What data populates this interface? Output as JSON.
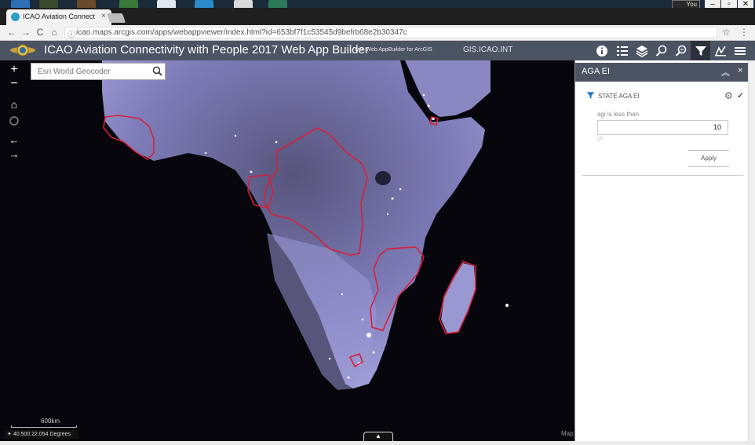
{
  "os": {
    "user_label": "You"
  },
  "browser": {
    "tab_title": "ICAO Aviation Connecti",
    "tab_close": "×",
    "url": "icao.maps.arcgis.com/apps/webappviewer/index.html?id=653bf7f1c53545d9befrb68e2b30347c",
    "back": "←",
    "forward": "→",
    "reload": "C",
    "home": "⌂",
    "info": "ⓘ",
    "star": "☆",
    "menu": "⋮"
  },
  "app": {
    "title": "ICAO Aviation Connectivity with People 2017 Web App Builder",
    "subtitle": "with Web AppBuilder for ArcGIS",
    "link": "GIS.ICAO.INT",
    "header_icons": [
      "info-icon",
      "legend-icon",
      "layers-icon",
      "query-icon",
      "query-alt-icon",
      "filter-icon",
      "analysis-icon",
      "menu-icon"
    ]
  },
  "map": {
    "zoom_in": "+",
    "zoom_out": "−",
    "home": "⌂",
    "back": "←",
    "forward": "→",
    "search_placeholder": "Esri World Geocoder",
    "scale_label": "600km",
    "coordinates": "40.500 22.054 Degrees",
    "attribution_toggle": "▲",
    "attribution": "Map"
  },
  "panel": {
    "title": "AGA EI",
    "collapse": "︽",
    "close": "×",
    "filter_name": "STATE AGA EI",
    "expression_label": "agi is less than",
    "expression_value": "10",
    "expression_hint": "ph",
    "apply_label": "Apply",
    "gear": "⚙",
    "check": "✓"
  },
  "colors": {
    "header": "#4c5464",
    "land": "#8e8cc8",
    "ocean": "#06060c",
    "border_highlight": "#d6203a"
  }
}
